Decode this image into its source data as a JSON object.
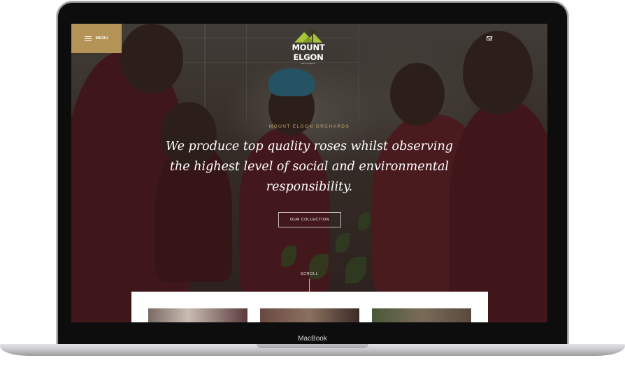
{
  "device": {
    "brand_label": "MacBook"
  },
  "header": {
    "menu_label": "MENU",
    "logo_name": "MOUNT ELGON",
    "logo_sub": "ORCHARDS",
    "icons": [
      "menu-icon",
      "mail-icon"
    ]
  },
  "hero": {
    "eyebrow": "MOUNT ELGON ORCHARDS",
    "headline": "We produce top quality roses whilst observing the highest level of social and environmental responsibility.",
    "cta_label": "OUR COLLECTION",
    "scroll_label": "SCROLL"
  },
  "colors": {
    "accent": "#b49356",
    "eyebrow": "#c9a86a",
    "logo_green": "#a7c43a"
  }
}
